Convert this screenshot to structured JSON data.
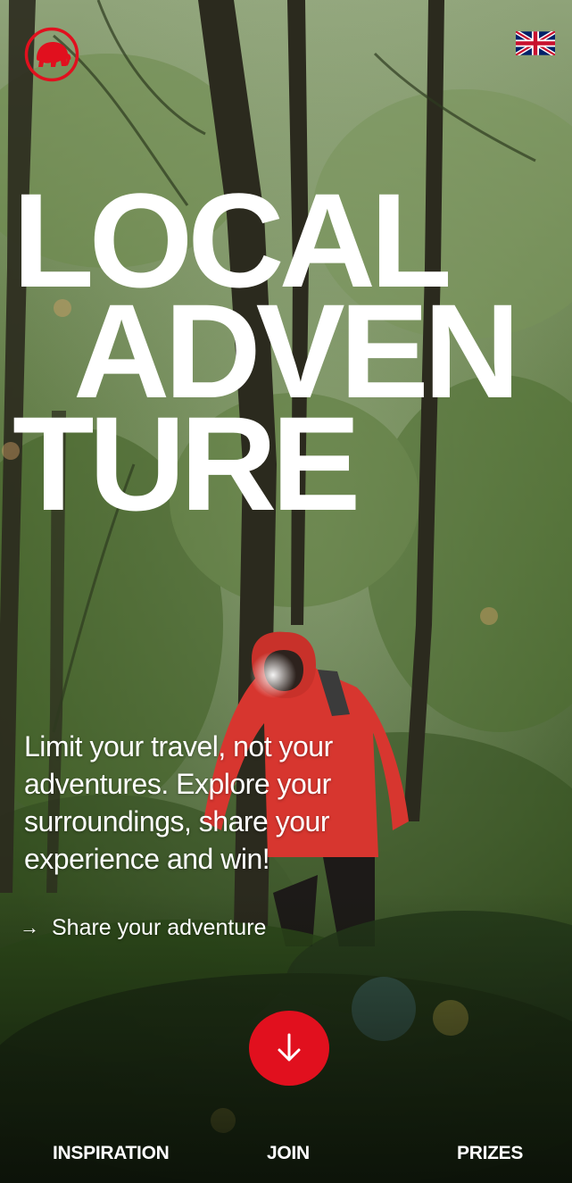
{
  "brand": {
    "logo_icon": "mammoth-logo-icon",
    "accent_color": "#e1101e"
  },
  "language": {
    "icon": "uk-flag-icon"
  },
  "hero": {
    "headline_lines": [
      "LOCAL",
      "ADVEN",
      "TURE"
    ],
    "intro": "Limit your travel, not your adventures. Explore your surroundings, share your experience and win!",
    "cta_label": "Share your adventure",
    "cta_icon": "arrow-right-icon",
    "scroll_icon": "arrow-down-icon"
  },
  "nav": {
    "items": [
      "INSPIRATION",
      "JOIN",
      "PRIZES"
    ]
  }
}
